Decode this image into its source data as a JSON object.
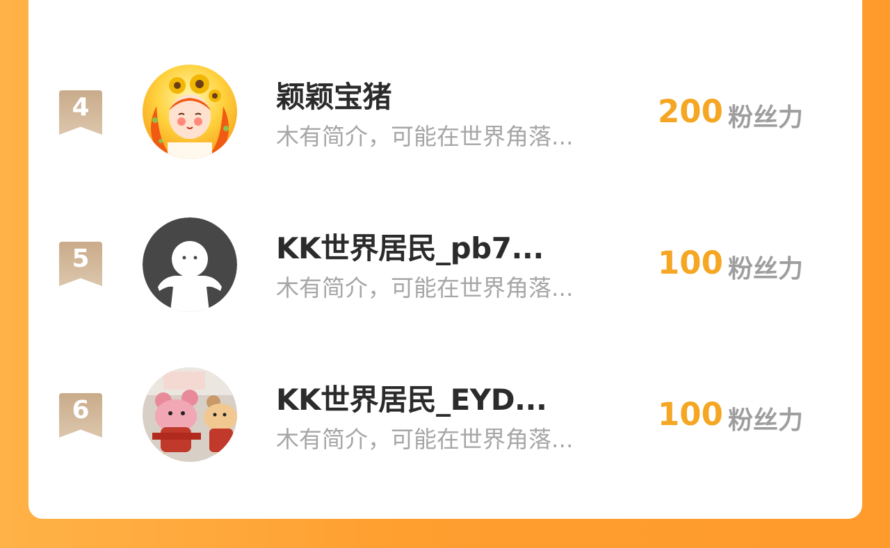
{
  "ranking": {
    "items": [
      {
        "rank": "4",
        "name": "颖颖宝猪",
        "bio": "木有简介，可能在世界角落...",
        "fans": "200",
        "fans_unit": "粉丝力",
        "avatar_icon": "sunflower-girl-avatar-icon"
      },
      {
        "rank": "5",
        "name": "KK世界居民_pb7...",
        "bio": "木有简介，可能在世界角落...",
        "fans": "100",
        "fans_unit": "粉丝力",
        "avatar_icon": "default-user-avatar-icon"
      },
      {
        "rank": "6",
        "name": "KK世界居民_EYD...",
        "bio": "木有简介，可能在世界角落...",
        "fans": "100",
        "fans_unit": "粉丝力",
        "avatar_icon": "mouse-plush-avatar-icon"
      }
    ]
  },
  "colors": {
    "background": "#ff9f30",
    "fans_number": "#f5a623",
    "rank_badge": "#c9ab8a"
  }
}
